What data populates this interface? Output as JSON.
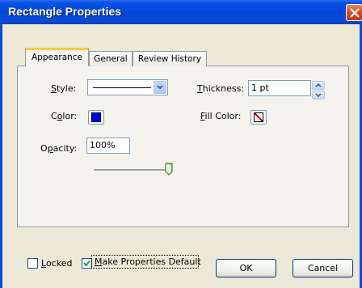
{
  "window": {
    "title": "Rectangle Properties"
  },
  "tabs": [
    {
      "label": "Appearance",
      "active": true
    },
    {
      "label": "General",
      "active": false
    },
    {
      "label": "Review History",
      "active": false
    }
  ],
  "appearance": {
    "style_label": "Style:",
    "style_mnemonic": "S",
    "style_rest": "tyle:",
    "thickness_label_m": "T",
    "thickness_label_rest": "hickness:",
    "thickness_value": "1 pt",
    "color_label_pre": "C",
    "color_label_m": "o",
    "color_label_rest": "lor:",
    "color_value": "#0000e6",
    "fill_label_m": "F",
    "fill_label_rest": "ill Color:",
    "fill_value": "none",
    "opacity_label_pre": "O",
    "opacity_label_m": "p",
    "opacity_label_rest": "acity:",
    "opacity_value": "100%",
    "opacity_slider_fraction": 1.0
  },
  "footer": {
    "locked_m": "L",
    "locked_rest": "ocked",
    "locked_checked": false,
    "make_default_m": "M",
    "make_default_rest": "ake Properties Default",
    "make_default_checked": true,
    "ok_label": "OK",
    "cancel_label": "Cancel"
  },
  "colors": {
    "titlebar": "#0045d8",
    "tab_highlight": "#ffc83c",
    "stroke_color": "#0000e6",
    "fill_slash": "#cc0000"
  },
  "icons": {
    "close": "close-icon",
    "dropdown": "chevron-down-icon",
    "spin_up": "spin-up-icon",
    "spin_down": "spin-down-icon",
    "check": "check-icon"
  }
}
